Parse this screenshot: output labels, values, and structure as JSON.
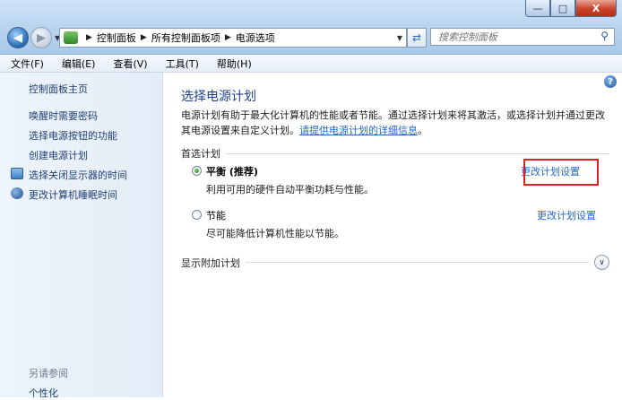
{
  "window": {
    "minimize": "—",
    "maximize": "□",
    "close": "X"
  },
  "address": {
    "crumbs": [
      "控制面板",
      "所有控制面板项",
      "电源选项"
    ]
  },
  "search": {
    "placeholder": "搜索控制面板"
  },
  "menu": [
    "文件(F)",
    "编辑(E)",
    "查看(V)",
    "工具(T)",
    "帮助(H)"
  ],
  "sidebar": {
    "home": "控制面板主页",
    "items": [
      {
        "label": "唤醒时需要密码",
        "icon": ""
      },
      {
        "label": "选择电源按钮的功能",
        "icon": ""
      },
      {
        "label": "创建电源计划",
        "icon": ""
      },
      {
        "label": "选择关闭显示器的时间",
        "icon": "monitor-icon"
      },
      {
        "label": "更改计算机睡眠时间",
        "icon": "moon-icon"
      }
    ],
    "see_also": "另请参阅",
    "personalize": "个性化"
  },
  "main": {
    "title": "选择电源计划",
    "description_1": "电源计划有助于最大化计算机的性能或者节能。通过选择计划来将其激活，或选择计划并通过更改其电源设置来自定义计划。",
    "description_link": "请提供电源计划的详细信息",
    "description_end": "。",
    "preferred_section": "首选计划",
    "plans": [
      {
        "name": "平衡 (推荐)",
        "description": "利用可用的硬件自动平衡功耗与性能。",
        "selected": true,
        "change_label": "更改计划设置"
      },
      {
        "name": "节能",
        "description": "尽可能降低计算机性能以节能。",
        "selected": false,
        "change_label": "更改计划设置"
      }
    ],
    "additional_section": "显示附加计划"
  },
  "colors": {
    "highlight": "#d92424",
    "link": "#2468c8",
    "title": "#1b3f8a"
  }
}
